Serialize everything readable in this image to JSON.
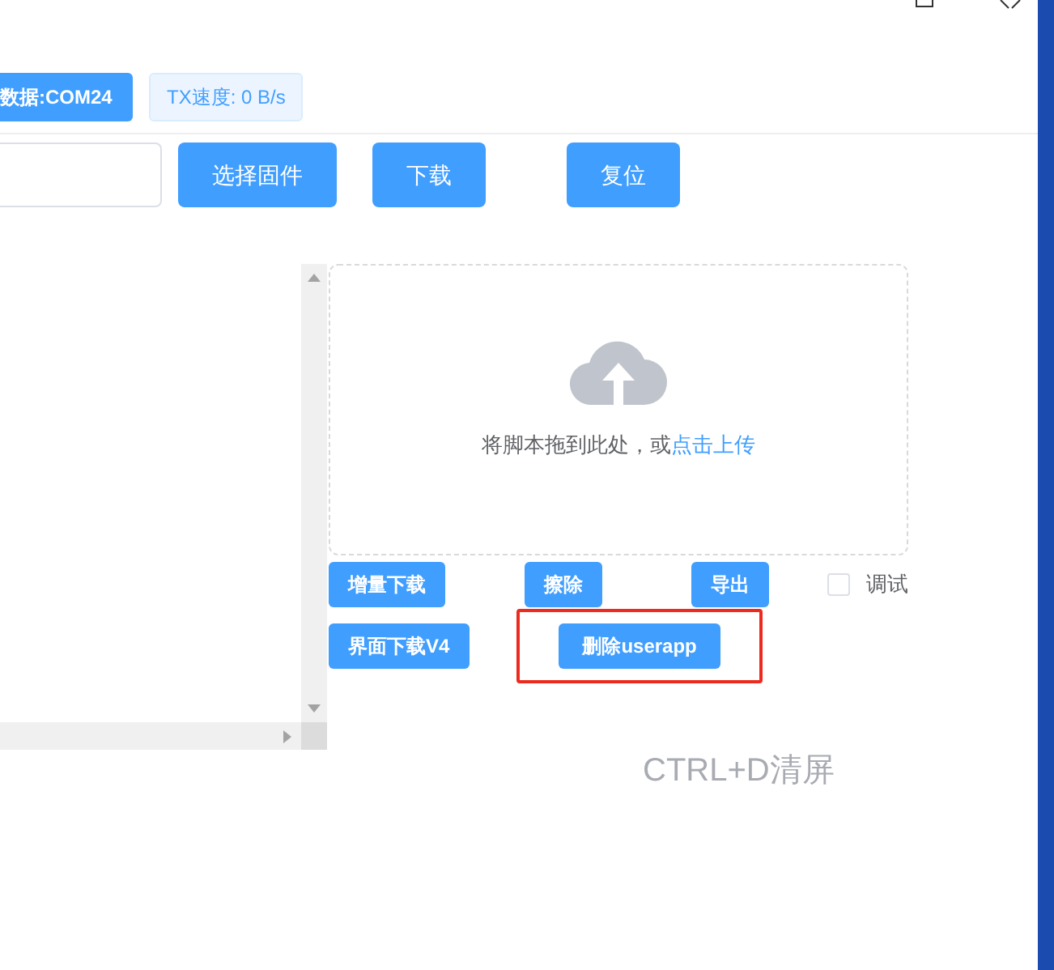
{
  "toolbar": {
    "port_button": "数据:COM24",
    "tx_badge": "TX速度: 0 B/s"
  },
  "firmware_buttons": [
    "选择固件",
    "下载",
    "复位"
  ],
  "upload": {
    "prompt": "将脚本拖到此处，或",
    "link": "点击上传"
  },
  "action_rows": [
    [
      {
        "label": "增量下载",
        "highlighted": false
      },
      {
        "label": "擦除",
        "highlighted": false
      },
      {
        "label": "导出",
        "highlighted": false
      }
    ],
    [
      {
        "label": "界面下载V4",
        "highlighted": false
      },
      {
        "label": "删除userapp",
        "highlighted": true
      }
    ]
  ],
  "debug": {
    "label": "调试",
    "checked": false
  },
  "hint": "CTRL+D清屏"
}
